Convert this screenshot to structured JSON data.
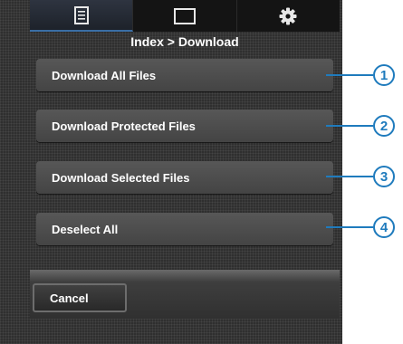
{
  "tabs": [
    {
      "icon": "list-icon",
      "active": true
    },
    {
      "icon": "screen-icon",
      "active": false
    },
    {
      "icon": "gear-icon",
      "active": false
    }
  ],
  "breadcrumb": "Index > Download",
  "menu": [
    {
      "label": "Download All Files",
      "callout": "1"
    },
    {
      "label": "Download Protected Files",
      "callout": "2"
    },
    {
      "label": "Download Selected Files",
      "callout": "3"
    },
    {
      "label": "Deselect All",
      "callout": "4"
    }
  ],
  "cancel_label": "Cancel",
  "colors": {
    "callout": "#1f7bbd",
    "active_tab_accent": "#3a6ea5"
  }
}
